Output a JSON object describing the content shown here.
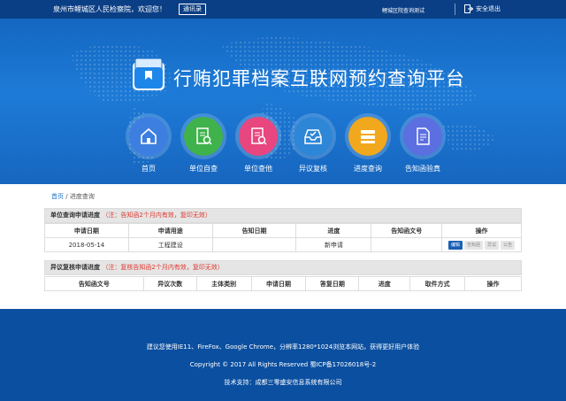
{
  "topbar": {
    "welcome": "泉州市鲤城区人民检察院，欢迎您！",
    "contact_label": "通讯录",
    "test_link": "鲤城区院查询测试",
    "logout_label": "安全退出"
  },
  "banner": {
    "title": "行贿犯罪档案互联网预约查询平台",
    "nav": [
      {
        "label": "首页",
        "icon": "home-icon",
        "color": "#3d7fe0"
      },
      {
        "label": "单位自查",
        "icon": "doc-search-icon",
        "color": "#3fb24b"
      },
      {
        "label": "单位查他",
        "icon": "doc-search-icon",
        "color": "#e8467f"
      },
      {
        "label": "异议复核",
        "icon": "inbox-check-icon",
        "color": "#2e86d6"
      },
      {
        "label": "进度查询",
        "icon": "list-icon",
        "color": "#f2a81d"
      },
      {
        "label": "告知函验真",
        "icon": "doc-verify-icon",
        "color": "#5b6fe0"
      }
    ]
  },
  "breadcrumb": {
    "home": "首页",
    "sep": "/",
    "current": "进度查询"
  },
  "section1": {
    "title": "单位查询申请进度",
    "note": "（注：告知函2个月内有效，复印无效）",
    "headers": [
      "申请日期",
      "申请用途",
      "告知日期",
      "进度",
      "告知函文号",
      "操作"
    ],
    "rows": [
      {
        "date": "2018-05-14",
        "purpose": "工程建设",
        "notify_date": "",
        "progress": "新申请",
        "doc_no": "",
        "actions": [
          "编辑",
          "告知函",
          "异议",
          "公告"
        ]
      }
    ]
  },
  "section2": {
    "title": "异议复核申请进度",
    "note": "（注：复核告知函2个月内有效，复印无效）",
    "headers": [
      "告知函文号",
      "异议次数",
      "主体类别",
      "申请日期",
      "答复日期",
      "进度",
      "取件方式",
      "操作"
    ]
  },
  "footer": {
    "line1": "建议您使用IE11、FireFox、Google Chrome，分辨率1280*1024浏览本网站，获得更好用户体验",
    "line2": "Copyright © 2017 All Rights Reserved 蜀ICP备17026018号-2",
    "line3": "技术支持：成都三零盛安信息系统有限公司"
  },
  "colors": {
    "topbar": "#0a3f86",
    "banner": "#1a72cf",
    "footer": "#0b4fa0",
    "note": "#e0362d",
    "primary_btn": "#1a5fb4"
  }
}
